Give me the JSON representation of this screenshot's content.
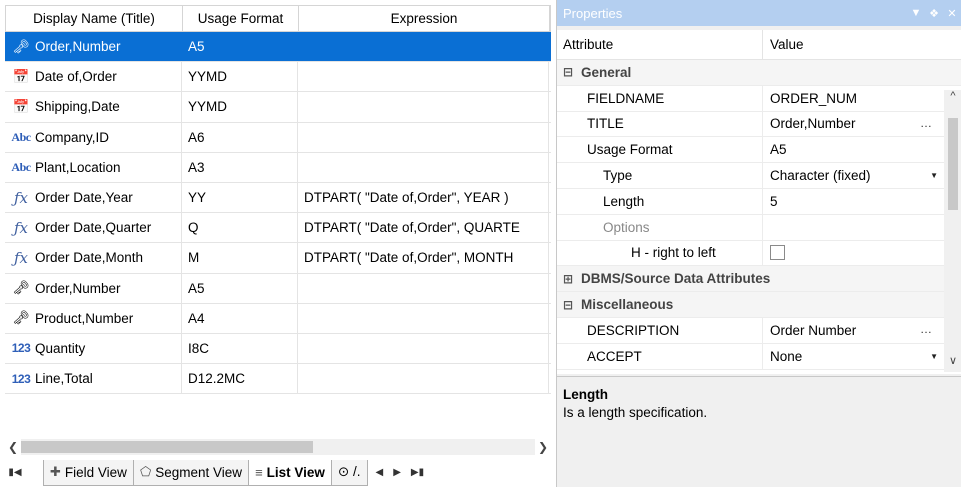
{
  "list": {
    "columns": [
      "Display Name (Title)",
      "Usage Format",
      "Expression"
    ],
    "rows": [
      {
        "icon": "key-link-icon",
        "name": "Order,Number",
        "format": "A5",
        "expr": "",
        "selected": true
      },
      {
        "icon": "calendar-icon",
        "name": "Date of,Order",
        "format": "YYMD",
        "expr": ""
      },
      {
        "icon": "calendar-icon",
        "name": "Shipping,Date",
        "format": "YYMD",
        "expr": ""
      },
      {
        "icon": "abc-icon",
        "name": "Company,ID",
        "format": "A6",
        "expr": ""
      },
      {
        "icon": "abc-icon",
        "name": "Plant,Location",
        "format": "A3",
        "expr": ""
      },
      {
        "icon": "fx-icon",
        "name": "Order Date,Year",
        "format": "YY",
        "expr": "DTPART( \"Date of,Order\", YEAR )"
      },
      {
        "icon": "fx-icon",
        "name": "Order Date,Quarter",
        "format": "Q",
        "expr": "DTPART( \"Date of,Order\", QUARTE"
      },
      {
        "icon": "fx-icon",
        "name": "Order Date,Month",
        "format": "M",
        "expr": "DTPART( \"Date of,Order\", MONTH"
      },
      {
        "icon": "key-icon",
        "name": "Order,Number",
        "format": "A5",
        "expr": ""
      },
      {
        "icon": "key-icon",
        "name": "Product,Number",
        "format": "A4",
        "expr": ""
      },
      {
        "icon": "number-icon",
        "name": "Quantity",
        "format": "I8C",
        "expr": ""
      },
      {
        "icon": "number-icon",
        "name": "Line,Total",
        "format": "D12.2MC",
        "expr": ""
      }
    ]
  },
  "tabs": {
    "field_view": "Field View",
    "segment_view": "Segment View",
    "list_view": "List View",
    "overflow": "⊙ /."
  },
  "properties": {
    "title": "Properties",
    "header_attribute": "Attribute",
    "header_value": "Value",
    "rows": [
      {
        "kind": "group",
        "label": "General",
        "expanded": true
      },
      {
        "kind": "prop",
        "indent": 1,
        "label": "FIELDNAME",
        "value": "ORDER_NUM"
      },
      {
        "kind": "prop",
        "indent": 1,
        "label": "TITLE",
        "value": "Order,Number",
        "ellipsis": true
      },
      {
        "kind": "prop",
        "indent": 1,
        "label": "Usage Format",
        "value": "A5"
      },
      {
        "kind": "prop",
        "indent": 2,
        "label": "Type",
        "value": "Character (fixed)",
        "dropdown": true
      },
      {
        "kind": "prop",
        "indent": 2,
        "label": "Length",
        "value": "5"
      },
      {
        "kind": "prop",
        "indent": 2,
        "label": "Options",
        "value": "",
        "muted": true
      },
      {
        "kind": "prop",
        "indent": 3,
        "label": "H - right to left",
        "value": "",
        "checkbox": true
      },
      {
        "kind": "group",
        "label": "DBMS/Source Data Attributes",
        "expanded": false
      },
      {
        "kind": "group",
        "label": "Miscellaneous",
        "expanded": true
      },
      {
        "kind": "prop",
        "indent": 1,
        "label": "DESCRIPTION",
        "value": "Order Number",
        "ellipsis": true
      },
      {
        "kind": "prop",
        "indent": 1,
        "label": "ACCEPT",
        "value": "None",
        "dropdown": true
      }
    ],
    "description_title": "Length",
    "description_text": "Is a length specification."
  }
}
